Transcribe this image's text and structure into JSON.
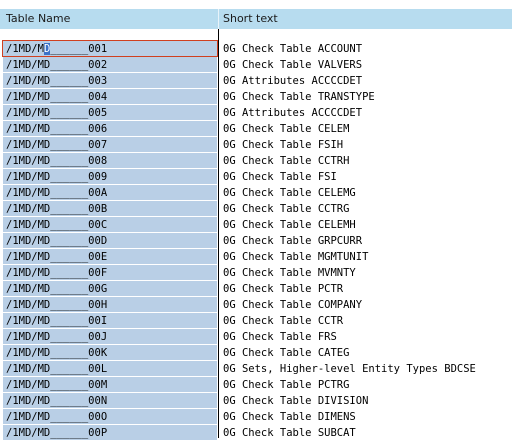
{
  "columns": {
    "name": "Table Name",
    "text": "Short text"
  },
  "active_row": {
    "prefix": "/1MD/M",
    "cursor_char": "D",
    "suffix": "______001"
  },
  "rows": [
    {
      "name": "/1MD/MD______001",
      "text": "0G Check Table ACCOUNT"
    },
    {
      "name": "/1MD/MD______002",
      "text": "0G Check Table VALVERS"
    },
    {
      "name": "/1MD/MD______003",
      "text": "0G Attributes ACCCCDET"
    },
    {
      "name": "/1MD/MD______004",
      "text": "0G Check Table TRANSTYPE"
    },
    {
      "name": "/1MD/MD______005",
      "text": "0G Attributes ACCCCDET"
    },
    {
      "name": "/1MD/MD______006",
      "text": "0G Check Table CELEM"
    },
    {
      "name": "/1MD/MD______007",
      "text": "0G Check Table FSIH"
    },
    {
      "name": "/1MD/MD______008",
      "text": "0G Check Table CCTRH"
    },
    {
      "name": "/1MD/MD______009",
      "text": "0G Check Table FSI"
    },
    {
      "name": "/1MD/MD______00A",
      "text": "0G Check Table CELEMG"
    },
    {
      "name": "/1MD/MD______00B",
      "text": "0G Check Table CCTRG"
    },
    {
      "name": "/1MD/MD______00C",
      "text": "0G Check Table CELEMH"
    },
    {
      "name": "/1MD/MD______00D",
      "text": "0G Check Table GRPCURR"
    },
    {
      "name": "/1MD/MD______00E",
      "text": "0G Check Table MGMTUNIT"
    },
    {
      "name": "/1MD/MD______00F",
      "text": "0G Check Table MVMNTY"
    },
    {
      "name": "/1MD/MD______00G",
      "text": "0G Check Table PCTR"
    },
    {
      "name": "/1MD/MD______00H",
      "text": "0G Check Table COMPANY"
    },
    {
      "name": "/1MD/MD______00I",
      "text": "0G Check Table CCTR"
    },
    {
      "name": "/1MD/MD______00J",
      "text": "0G Check Table FRS"
    },
    {
      "name": "/1MD/MD______00K",
      "text": "0G Check Table CATEG"
    },
    {
      "name": "/1MD/MD______00L",
      "text": "0G Sets, Higher-level Entity Types BDCSE"
    },
    {
      "name": "/1MD/MD______00M",
      "text": "0G Check Table PCTRG"
    },
    {
      "name": "/1MD/MD______00N",
      "text": "0G Check Table DIVISION"
    },
    {
      "name": "/1MD/MD______00O",
      "text": "0G Check Table DIMENS"
    },
    {
      "name": "/1MD/MD______00P",
      "text": "0G Check Table SUBCAT"
    }
  ]
}
